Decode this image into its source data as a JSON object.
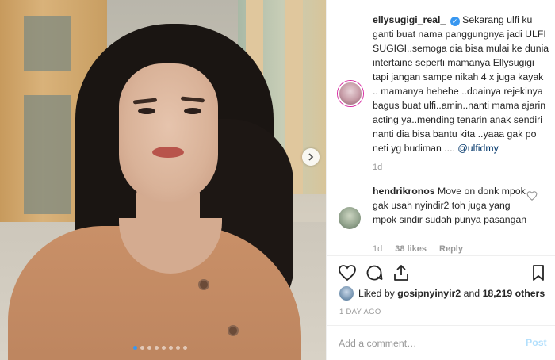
{
  "post": {
    "photo": {
      "carousel_dots": 8,
      "active_dot": 0,
      "next_icon": "chevron-right-icon"
    },
    "caption": {
      "username": "ellysugigi_real_",
      "verified_icon": "verified-badge-icon",
      "text": "Sekarang ulfi ku ganti buat nama panggungnya jadi ULFI SUGIGI..semoga dia bisa mulai ke dunia intertaine seperti mamanya Ellysugigi tapi jangan sampe nikah 4 x juga kayak .. mamanya hehehe ..doainya rejekinya bagus buat ulfi..amin..nanti mama ajarin acting ya..mending tenarin anak sendiri nanti dia bisa bantu kita ..yaaa gak po neti yg budiman ....",
      "mention": "@ulfidmy",
      "age": "1d"
    },
    "comments": [
      {
        "username": "hendrikronos",
        "text": "Move on donk mpok gak usah nyindir2 toh juga yang mpok sindir sudah punya pasangan",
        "age": "1d",
        "likes": "38 likes",
        "reply": "Reply"
      }
    ],
    "actions": {
      "like_icon": "heart-icon",
      "comment_icon": "comment-icon",
      "share_icon": "share-icon",
      "save_icon": "bookmark-icon"
    },
    "liked_by": {
      "prefix": "Liked by",
      "user": "gosipnyinyir2",
      "joiner": "and",
      "others": "18,219 others"
    },
    "timestamp": "1 DAY AGO",
    "add_comment": {
      "placeholder": "Add a comment…",
      "post_label": "Post"
    }
  },
  "colors": {
    "accent": "#3897f0",
    "post_disabled": "#b2dffc",
    "muted": "#999999"
  }
}
